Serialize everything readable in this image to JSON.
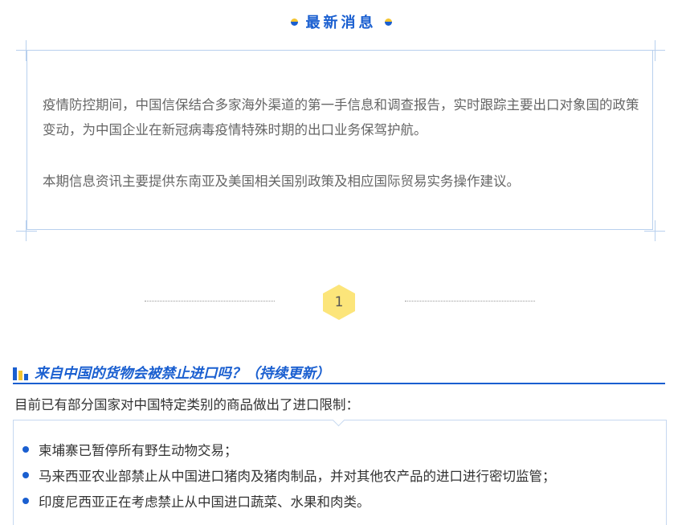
{
  "section": {
    "title": "最新消息"
  },
  "notice": {
    "paragraphs": [
      "疫情防控期间，中国信保结合多家海外渠道的第一手信息和调查报告，实时跟踪主要出口对象国的政策变动，为中国企业在新冠病毒疫情特殊时期的出口业务保驾护航。",
      "本期信息资讯主要提供东南亚及美国相关国别政策及相应国际贸易实务操作建议。"
    ]
  },
  "step": {
    "number": "1"
  },
  "article": {
    "title": "来自中国的货物会被禁止进口吗？（持续更新）",
    "intro": "目前已有部分国家对中国特定类别的商品做出了进口限制：",
    "items": [
      "柬埔寨已暂停所有野生动物交易；",
      "马来西亚农业部禁止从中国进口猪肉及猪肉制品，并对其他农产品的进口进行密切监管；",
      "印度尼西亚正在考虑禁止从中国进口蔬菜、水果和肉类。"
    ]
  },
  "colors": {
    "accent": "#1a5fd0",
    "highlight": "#f4c430",
    "badge": "#fce57a"
  }
}
